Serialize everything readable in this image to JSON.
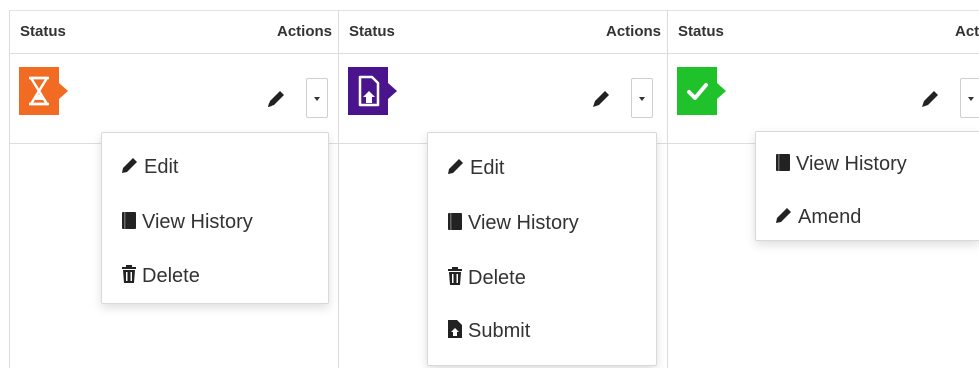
{
  "columns": [
    {
      "header": {
        "status": "Status",
        "actions": "Actions"
      },
      "status_badge": {
        "icon": "hourglass-icon",
        "color": "#f26b22"
      },
      "menu": [
        {
          "icon": "pencil-icon",
          "label": "Edit"
        },
        {
          "icon": "book-icon",
          "label": "View History"
        },
        {
          "icon": "trash-icon",
          "label": "Delete"
        }
      ]
    },
    {
      "header": {
        "status": "Status",
        "actions": "Actions"
      },
      "status_badge": {
        "icon": "file-upload-icon",
        "color": "#4a148c"
      },
      "menu": [
        {
          "icon": "pencil-icon",
          "label": "Edit"
        },
        {
          "icon": "book-icon",
          "label": "View History"
        },
        {
          "icon": "trash-icon",
          "label": "Delete"
        },
        {
          "icon": "file-submit-icon",
          "label": "Submit"
        }
      ]
    },
    {
      "header": {
        "status": "Status",
        "actions": "Actions"
      },
      "status_badge": {
        "icon": "check-icon",
        "color": "#1fc22b"
      },
      "menu": [
        {
          "icon": "book-icon",
          "label": "View History"
        },
        {
          "icon": "pencil-icon",
          "label": "Amend"
        }
      ]
    }
  ]
}
